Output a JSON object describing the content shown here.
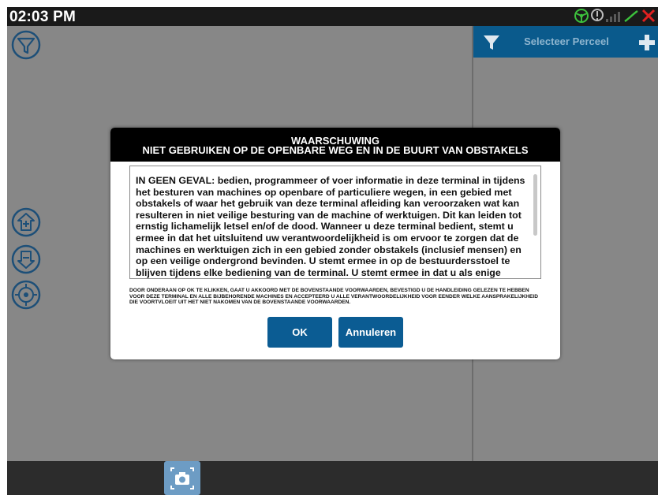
{
  "status": {
    "time": "02:03 PM",
    "icons": [
      "steering-wheel-icon",
      "info-icon",
      "signal-icon",
      "gps-icon",
      "error-x-icon"
    ]
  },
  "panel": {
    "title": "Selecteer Perceel",
    "filter_icon": "filter-icon",
    "add_icon": "plus-icon"
  },
  "map_tools": [
    "filter-icon",
    "zoom-in-icon",
    "zoom-out-icon",
    "locate-icon"
  ],
  "dialog": {
    "title_line1": "WAARSCHUWING",
    "title_line2": "NIET GEBRUIKEN OP DE OPENBARE WEG EN IN DE BUURT VAN OBSTAKELS",
    "body": "IN GEEN GEVAL: bedien, programmeer of voer informatie in deze terminal in tijdens het besturen van machines op openbare of particuliere wegen, in een gebied met obstakels of waar het gebruik van deze terminal afleiding kan veroorzaken wat kan resulteren in niet veilige besturing van de machine of werktuigen. Dit kan leiden tot ernstig lichamelijk letsel en/of de dood. Wanneer u deze terminal bedient, stemt u ermee in dat het uitsluitend uw verantwoordelijkheid is om ervoor te zorgen dat de machines en werktuigen zich in een gebied zonder obstakels (inclusief mensen) en op een veilige ondergrond bevinden. U stemt ermee in op de bestuurdersstoel te blijven tijdens elke bediening van de terminal. U stemt ermee in dat u als enige verantwoordelijk bent voor alle schade en aansprakelijkheid voor schade",
    "disclaimer": "DOOR ONDERAAN OP OK TE KLIKKEN, GAAT U AKKOORD MET DE BOVENSTAANDE VOORWAARDEN, BEVESTIGD U DE HANDLEIDING GELEZEN TE HEBBEN VOOR DEZE TERMINAL EN ALLE BIJBEHORENDE MACHINES EN ACCEPTEERD U ALLE VERANTWOORDELIJKHEID VOOR EENDER WELKE AANSPRAKELIJKHEID DIE VOORTVLOEIT UIT HET NIET NAKOMEN VAN DE BOVENSTAANDE VOORWAARDEN.",
    "ok_label": "OK",
    "cancel_label": "Annuleren"
  },
  "bottom": {
    "camera_icon": "camera-icon"
  },
  "colors": {
    "accent": "#0b5c93",
    "map_background": "#878787",
    "status_ok": "#3cc13c",
    "status_error": "#e02020"
  }
}
